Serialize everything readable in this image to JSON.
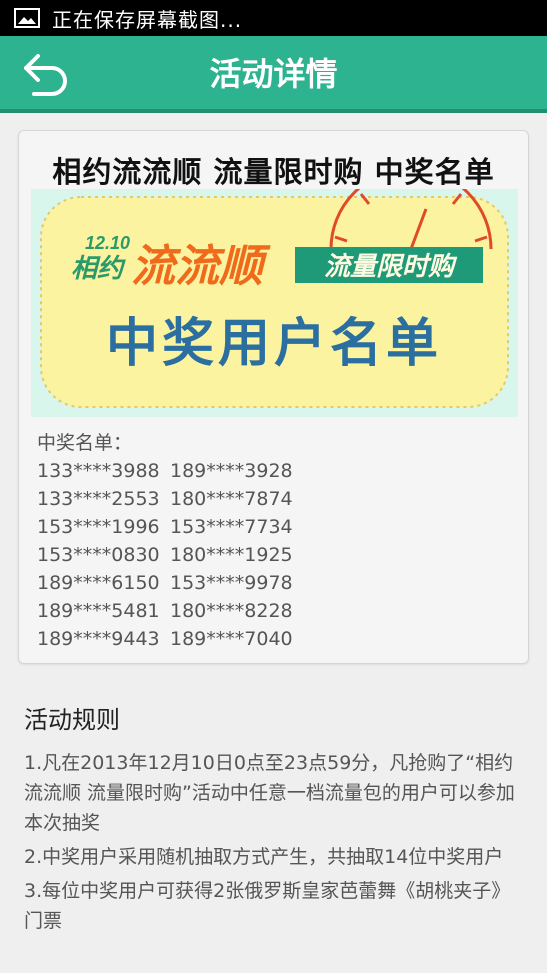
{
  "status_bar": {
    "text": "正在保存屏幕截图..."
  },
  "app_bar": {
    "title": "活动详情"
  },
  "card": {
    "title": "相约流流顺 流量限时购 中奖名单",
    "banner": {
      "date": "12.10",
      "word1": "相约",
      "word2": "流流顺",
      "tag": "流量限时购",
      "headline": "中奖用户名单"
    },
    "winners_label": "中奖名单：",
    "winners": [
      [
        "133****3988",
        "189****3928"
      ],
      [
        "133****2553",
        "180****7874"
      ],
      [
        "153****1996",
        "153****7734"
      ],
      [
        "153****0830",
        "180****1925"
      ],
      [
        "189****6150",
        "153****9978"
      ],
      [
        "189****5481",
        "180****8228"
      ],
      [
        "189****9443",
        "189****7040"
      ]
    ]
  },
  "rules": {
    "heading": "活动规则",
    "items": [
      "1.凡在2013年12月10日0点至23点59分，凡抢购了“相约流流顺 流量限时购”活动中任意一档流量包的用户可以参加本次抽奖",
      "2.中奖用户采用随机抽取方式产生，共抽取14位中奖用户",
      "3.每位中奖用户可获得2张俄罗斯皇家芭蕾舞《胡桃夹子》门票"
    ]
  }
}
